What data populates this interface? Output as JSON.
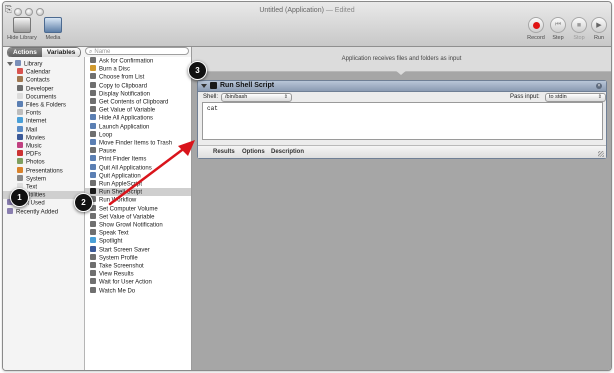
{
  "window": {
    "title": "Untitled (Application)",
    "edited": " — Edited"
  },
  "toolbar": {
    "hide_library": "Hide Library",
    "media": "Media",
    "record": "Record",
    "step": "Step",
    "stop": "Stop",
    "run": "Run"
  },
  "library": {
    "tab_actions": "Actions",
    "tab_variables": "Variables",
    "search_placeholder": "Name",
    "categories": [
      {
        "label": "Library",
        "color": "#7a8fb8"
      },
      {
        "label": "Calendar",
        "color": "#d9534f"
      },
      {
        "label": "Contacts",
        "color": "#a07850"
      },
      {
        "label": "Developer",
        "color": "#6c6c6c"
      },
      {
        "label": "Documents",
        "color": "#dcdcdc"
      },
      {
        "label": "Files & Folders",
        "color": "#5b7fb3"
      },
      {
        "label": "Fonts",
        "color": "#bdbdbd"
      },
      {
        "label": "Internet",
        "color": "#4aa0d8"
      },
      {
        "label": "Mail",
        "color": "#5a8cc7"
      },
      {
        "label": "Movies",
        "color": "#3b5998"
      },
      {
        "label": "Music",
        "color": "#c04080"
      },
      {
        "label": "PDFs",
        "color": "#cc3333"
      },
      {
        "label": "Photos",
        "color": "#7f9f5f"
      },
      {
        "label": "Presentations",
        "color": "#d9822b"
      },
      {
        "label": "System",
        "color": "#888888"
      },
      {
        "label": "Text",
        "color": "#dddddd"
      },
      {
        "label": "Utilities",
        "color": "#9a9a9a"
      },
      {
        "label": "Most Used",
        "color": "#8a7fb0"
      },
      {
        "label": "Recently Added",
        "color": "#8a7fb0"
      }
    ],
    "actions": [
      {
        "label": "Ask for Confirmation",
        "color": "#6f6f6f"
      },
      {
        "label": "Burn a Disc",
        "color": "#d19a2e"
      },
      {
        "label": "Choose from List",
        "color": "#6f6f6f"
      },
      {
        "label": "Copy to Clipboard",
        "color": "#6f6f6f"
      },
      {
        "label": "Display Notification",
        "color": "#6f6f6f"
      },
      {
        "label": "Get Contents of Clipboard",
        "color": "#6f6f6f"
      },
      {
        "label": "Get Value of Variable",
        "color": "#6f6f6f"
      },
      {
        "label": "Hide All Applications",
        "color": "#5b7fb3"
      },
      {
        "label": "Launch Application",
        "color": "#5b7fb3"
      },
      {
        "label": "Loop",
        "color": "#6f6f6f"
      },
      {
        "label": "Move Finder Items to Trash",
        "color": "#5b7fb3"
      },
      {
        "label": "Pause",
        "color": "#6f6f6f"
      },
      {
        "label": "Print Finder Items",
        "color": "#5b7fb3"
      },
      {
        "label": "Quit All Applications",
        "color": "#5b7fb3"
      },
      {
        "label": "Quit Application",
        "color": "#5b7fb3"
      },
      {
        "label": "Run AppleScript",
        "color": "#6f6f6f"
      },
      {
        "label": "Run Shell Script",
        "color": "#1a1a1a"
      },
      {
        "label": "Run Workflow",
        "color": "#6f6f6f"
      },
      {
        "label": "Set Computer Volume",
        "color": "#6f6f6f"
      },
      {
        "label": "Set Value of Variable",
        "color": "#6f6f6f"
      },
      {
        "label": "Show Growl Notification",
        "color": "#6f6f6f"
      },
      {
        "label": "Speak Text",
        "color": "#6f6f6f"
      },
      {
        "label": "Spotlight",
        "color": "#4aa0d8"
      },
      {
        "label": "Start Screen Saver",
        "color": "#3b5998"
      },
      {
        "label": "System Profile",
        "color": "#6f6f6f"
      },
      {
        "label": "Take Screenshot",
        "color": "#6f6f6f"
      },
      {
        "label": "View Results",
        "color": "#6f6f6f"
      },
      {
        "label": "Wait for User Action",
        "color": "#6f6f6f"
      },
      {
        "label": "Watch Me Do",
        "color": "#6f6f6f"
      }
    ]
  },
  "workflow": {
    "receives_text": "Application receives files and folders as input",
    "action": {
      "title": "Run Shell Script",
      "shell_label": "Shell:",
      "shell_value": "/bin/bash",
      "pass_input_label": "Pass input:",
      "pass_input_value": "to stdin",
      "script": "cat",
      "tabs": [
        "Results",
        "Options",
        "Description"
      ]
    }
  },
  "annotations": [
    {
      "number": "1"
    },
    {
      "number": "2"
    },
    {
      "number": "3"
    }
  ]
}
